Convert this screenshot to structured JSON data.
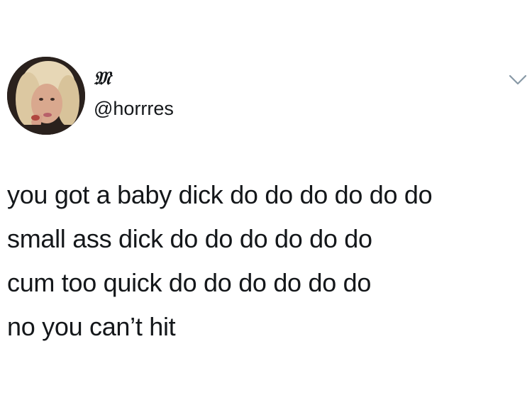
{
  "tweet": {
    "author": {
      "display_name": "𝔐",
      "handle": "@horrres",
      "avatar_icon": "profile-photo-avatar"
    },
    "menu_icon": "chevron-down-icon",
    "text_lines": [
      "you got a baby dick do do do do do do",
      "small ass dick do do do do do do",
      "cum too quick do do do do do do",
      "no you can’t hit"
    ]
  },
  "colors": {
    "background": "#ffffff",
    "text": "#14171a",
    "chevron": "#8899a6"
  }
}
